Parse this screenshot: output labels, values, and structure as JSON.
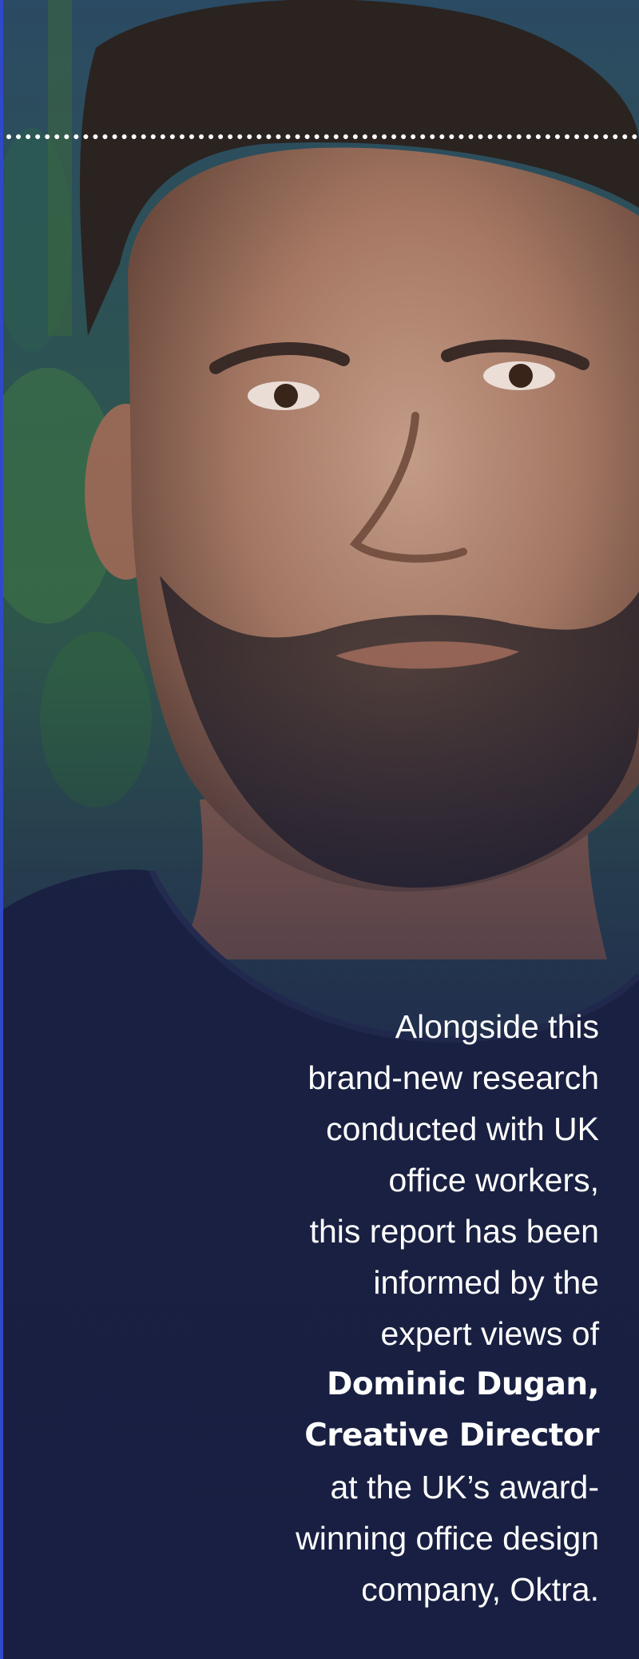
{
  "image": {
    "subject": "portrait-photo"
  },
  "colors": {
    "accent_edge": "#2f49c9",
    "overlay": "#1c2448",
    "text": "#ffffff"
  },
  "quote": {
    "lines": [
      "Alongside this",
      "brand-new research",
      "conducted with UK",
      "office workers,",
      "this report has been",
      "informed by the",
      "expert views of"
    ],
    "name_line": "Dominic Dugan,",
    "role_line": "Creative Director",
    "tail_lines": [
      "at the UK’s award-",
      "winning office design",
      "company, Oktra."
    ]
  }
}
